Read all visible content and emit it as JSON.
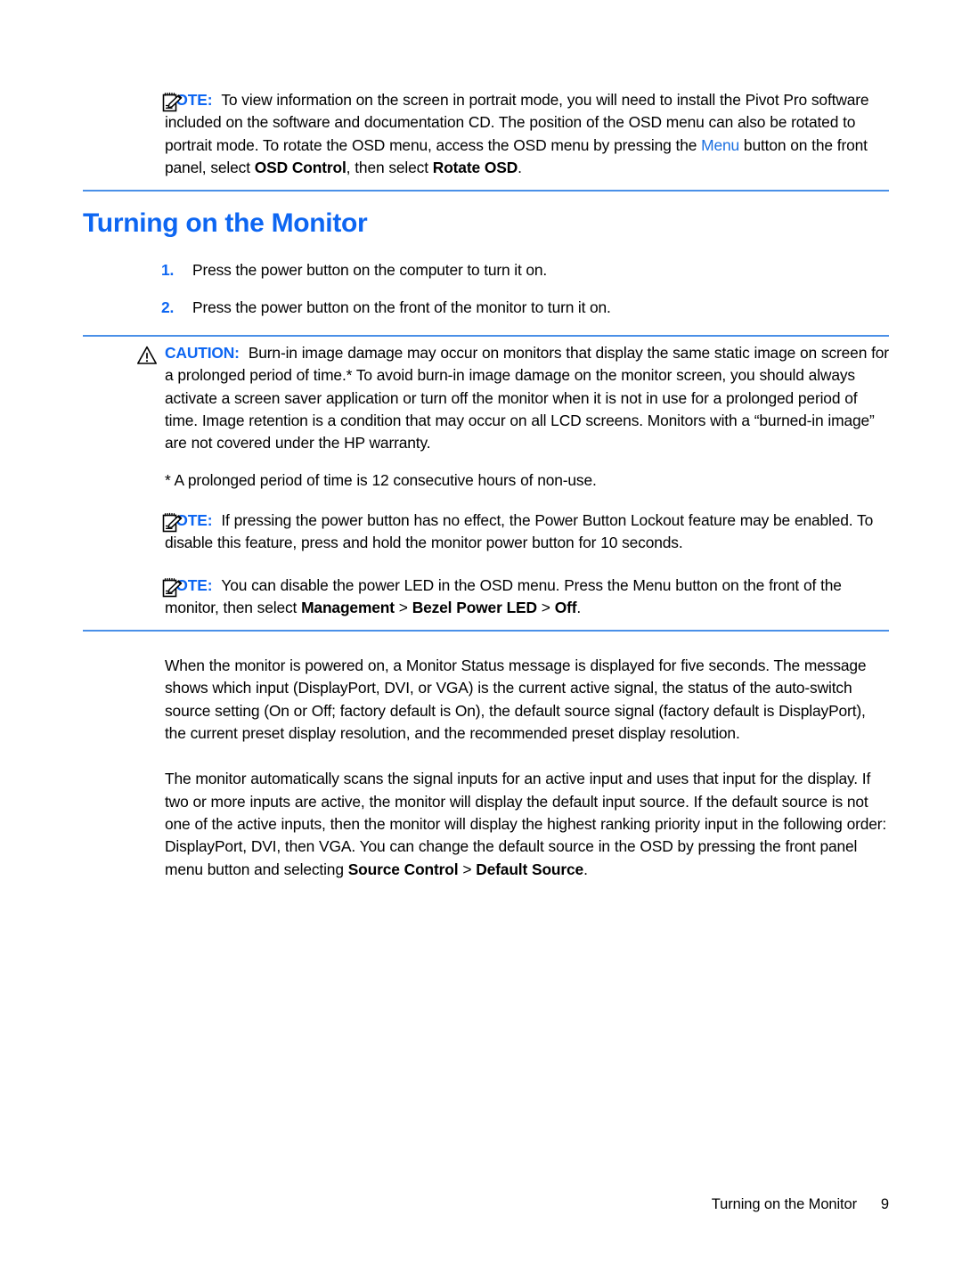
{
  "page": {
    "background": "#ffffff",
    "accent_blue": "#0d66f2",
    "rule_blue": "#4a90e8",
    "xref_blue": "#1a6fe0"
  },
  "note1": {
    "icon": "note-pad-pencil-icon",
    "label": "NOTE:",
    "text_part1": "To view information on the screen in portrait mode, you will need to install the Pivot Pro software included on the software and documentation CD. The position of the OSD menu can also be rotated to portrait mode. To rotate the OSD menu, access the OSD menu by pressing the ",
    "xref": "Menu",
    "text_part2": " button on the front panel, select ",
    "bold1": "OSD Control",
    "text_part3": ", then select ",
    "bold2": "Rotate OSD",
    "text_part4": "."
  },
  "heading": {
    "title": "Turning on the Monitor"
  },
  "steps": [
    {
      "num": "1.",
      "text": "Press the power button on the computer to turn it on."
    },
    {
      "num": "2.",
      "text": "Press the power button on the front of the monitor to turn it on."
    }
  ],
  "caution": {
    "icon": "warning-triangle-icon",
    "label": "CAUTION:",
    "text": "Burn-in image damage may occur on monitors that display the same static image on screen for a prolonged period of time.* To avoid burn-in image damage on the monitor screen, you should always activate a screen saver application or turn off the monitor when it is not in use for a prolonged period of time. Image retention is a condition that may occur on all LCD screens. Monitors with a “burned-in image” are not covered under the HP warranty."
  },
  "footnote": {
    "text": "* A prolonged period of time is 12 consecutive hours of non-use."
  },
  "note2": {
    "icon": "note-pad-pencil-icon",
    "label": "NOTE:",
    "text": "If pressing the power button has no effect, the Power Button Lockout feature may be enabled. To disable this feature, press and hold the monitor power button for 10 seconds."
  },
  "note3": {
    "icon": "note-pad-pencil-icon",
    "label": "NOTE:",
    "text_part1": "You can disable the power LED in the OSD menu. Press the Menu button on the front of the monitor, then select ",
    "bold1": "Management",
    "sep1": " > ",
    "bold2": "Bezel Power LED",
    "sep2": " > ",
    "bold3": "Off",
    "text_part2": "."
  },
  "paragraph1": {
    "text": "When the monitor is powered on, a Monitor Status message is displayed for five seconds. The message shows which input (DisplayPort, DVI, or VGA) is the current active signal, the status of the auto-switch source setting (On or Off; factory default is On), the default source signal (factory default is DisplayPort), the current preset display resolution, and the recommended preset display resolution."
  },
  "paragraph2": {
    "text_part1": "The monitor automatically scans the signal inputs for an active input and uses that input for the display. If two or more inputs are active, the monitor will display the default input source. If the default source is not one of the active inputs, then the monitor will display the highest ranking priority input in the following order: DisplayPort, DVI, then VGA. You can change the default source in the OSD by pressing the front panel menu button and selecting ",
    "bold1": "Source Control",
    "sep1": " > ",
    "bold2": "Default Source",
    "text_part2": "."
  },
  "footer": {
    "section_title": "Turning on the Monitor",
    "page_number": "9"
  }
}
